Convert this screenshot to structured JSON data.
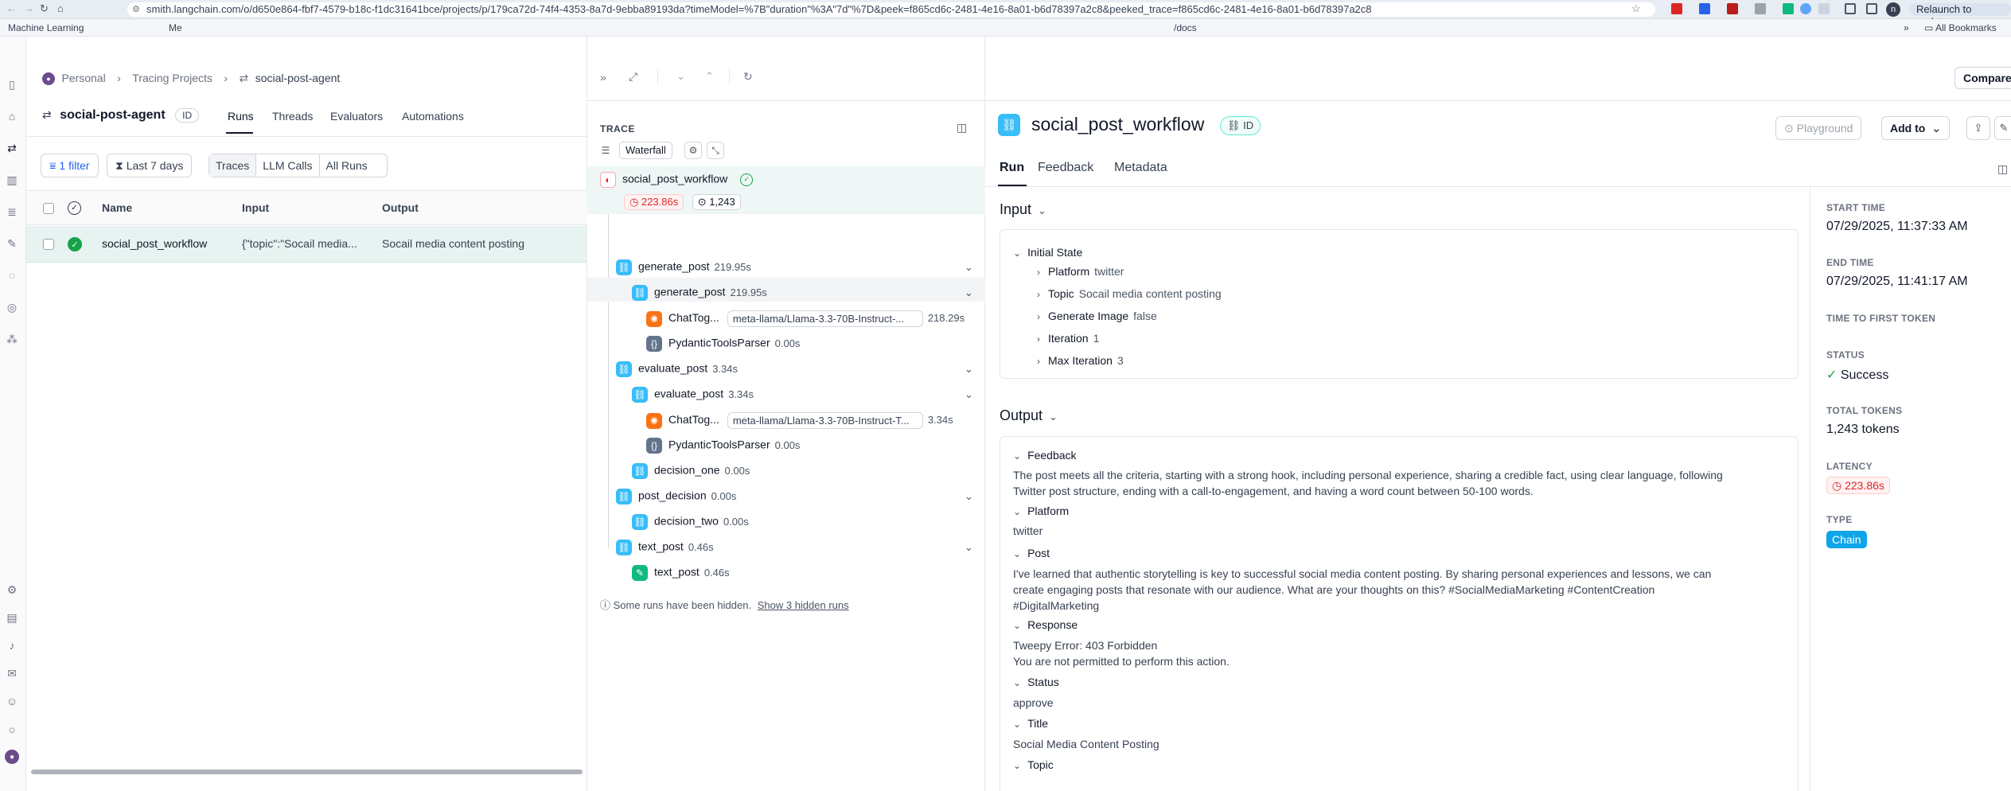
{
  "browser": {
    "url": "smith.langchain.com/o/d650e864-fbf7-4579-b18c-f1dc31641bce/projects/p/179ca72d-74f4-4353-8a7d-9ebba89193da?timeModel=%7B\"duration\"%3A\"7d\"%7D&peek=f865cd6c-2481-4e16-8a01-b6d78397a2c8&peeked_trace=f865cd6c-2481-4e16-8a01-b6d78397a2c8",
    "relaunch": "Relaunch to update",
    "avatar": "n",
    "bookmarks": [
      "Machine Learning",
      "Me",
      "/docs"
    ],
    "all_bookmarks": "All Bookmarks"
  },
  "breadcrumb": {
    "org": "Personal",
    "projects": "Tracing Projects",
    "project": "social-post-agent"
  },
  "project": {
    "name": "social-post-agent",
    "id_badge": "ID"
  },
  "tabs": [
    "Runs",
    "Threads",
    "Evaluators",
    "Automations"
  ],
  "filters": {
    "filter": "1 filter",
    "range": "Last 7 days",
    "segments": [
      "Traces",
      "LLM Calls",
      "All Runs"
    ]
  },
  "table": {
    "headers": [
      "Name",
      "Input",
      "Output"
    ],
    "rows": [
      {
        "name": "social_post_workflow",
        "input": "{\"topic\":\"Socail media...",
        "output": "Socail media content posting"
      }
    ]
  },
  "trace": {
    "title": "TRACE",
    "waterfall": "Waterfall",
    "root": {
      "name": "social_post_workflow",
      "latency": "223.86s",
      "tokens": "1,243"
    },
    "nodes": [
      {
        "name": "generate_post",
        "dur": "219.95s"
      },
      {
        "name": "generate_post",
        "dur": "219.95s"
      },
      {
        "name": "ChatTog...",
        "model": "meta-llama/Llama-3.3-70B-Instruct-...",
        "dur": "218.29s"
      },
      {
        "name": "PydanticToolsParser",
        "dur": "0.00s"
      },
      {
        "name": "evaluate_post",
        "dur": "3.34s"
      },
      {
        "name": "evaluate_post",
        "dur": "3.34s"
      },
      {
        "name": "ChatTog...",
        "model": "meta-llama/Llama-3.3-70B-Instruct-T...",
        "dur": "3.34s"
      },
      {
        "name": "PydanticToolsParser",
        "dur": "0.00s"
      },
      {
        "name": "decision_one",
        "dur": "0.00s"
      },
      {
        "name": "post_decision",
        "dur": "0.00s"
      },
      {
        "name": "decision_two",
        "dur": "0.00s"
      },
      {
        "name": "text_post",
        "dur": "0.46s"
      },
      {
        "name": "text_post",
        "dur": "0.46s"
      }
    ],
    "hidden_note": "Some runs have been hidden.",
    "hidden_link": "Show 3 hidden runs"
  },
  "detail": {
    "title": "social_post_workflow",
    "id_badge": "ID",
    "compare": "Compare",
    "playground": "Playground",
    "add_to": "Add to",
    "tabs": [
      "Run",
      "Feedback",
      "Metadata"
    ],
    "input_label": "Input",
    "output_label": "Output",
    "initial_state": "Initial State",
    "input_fields": [
      {
        "k": "Platform",
        "v": "twitter"
      },
      {
        "k": "Topic",
        "v": "Socail media content posting"
      },
      {
        "k": "Generate Image",
        "v": "false"
      },
      {
        "k": "Iteration",
        "v": "1"
      },
      {
        "k": "Max Iteration",
        "v": "3"
      }
    ],
    "output": {
      "feedback_k": "Feedback",
      "feedback_v1": "The post meets all the criteria, starting with a strong hook, including personal experience, sharing a credible fact, using clear language, following",
      "feedback_v2": "Twitter post structure, ending with a call-to-engagement, and having a word count between 50-100 words.",
      "platform_k": "Platform",
      "platform_v": "twitter",
      "post_k": "Post",
      "post_v1": "I've learned that authentic storytelling is key to successful social media content posting. By sharing personal experiences and lessons, we can",
      "post_v2": "create engaging posts that resonate with our audience. What are your thoughts on this? #SocialMediaMarketing #ContentCreation",
      "post_v3": "#DigitalMarketing",
      "response_k": "Response",
      "response_v1": "Tweepy Error: 403 Forbidden",
      "response_v2": "You are not permitted to perform this action.",
      "status_k": "Status",
      "status_v": "approve",
      "title_k": "Title",
      "title_v": "Social Media Content Posting",
      "topic_k": "Topic"
    },
    "meta": {
      "start_label": "START TIME",
      "start": "07/29/2025, 11:37:33 AM",
      "end_label": "END TIME",
      "end": "07/29/2025, 11:41:17 AM",
      "ttft_label": "TIME TO FIRST TOKEN",
      "status_label": "STATUS",
      "status": "Success",
      "tokens_label": "TOTAL TOKENS",
      "tokens": "1,243 tokens",
      "latency_label": "LATENCY",
      "latency": "223.86s",
      "type_label": "TYPE",
      "type": "Chain"
    }
  }
}
